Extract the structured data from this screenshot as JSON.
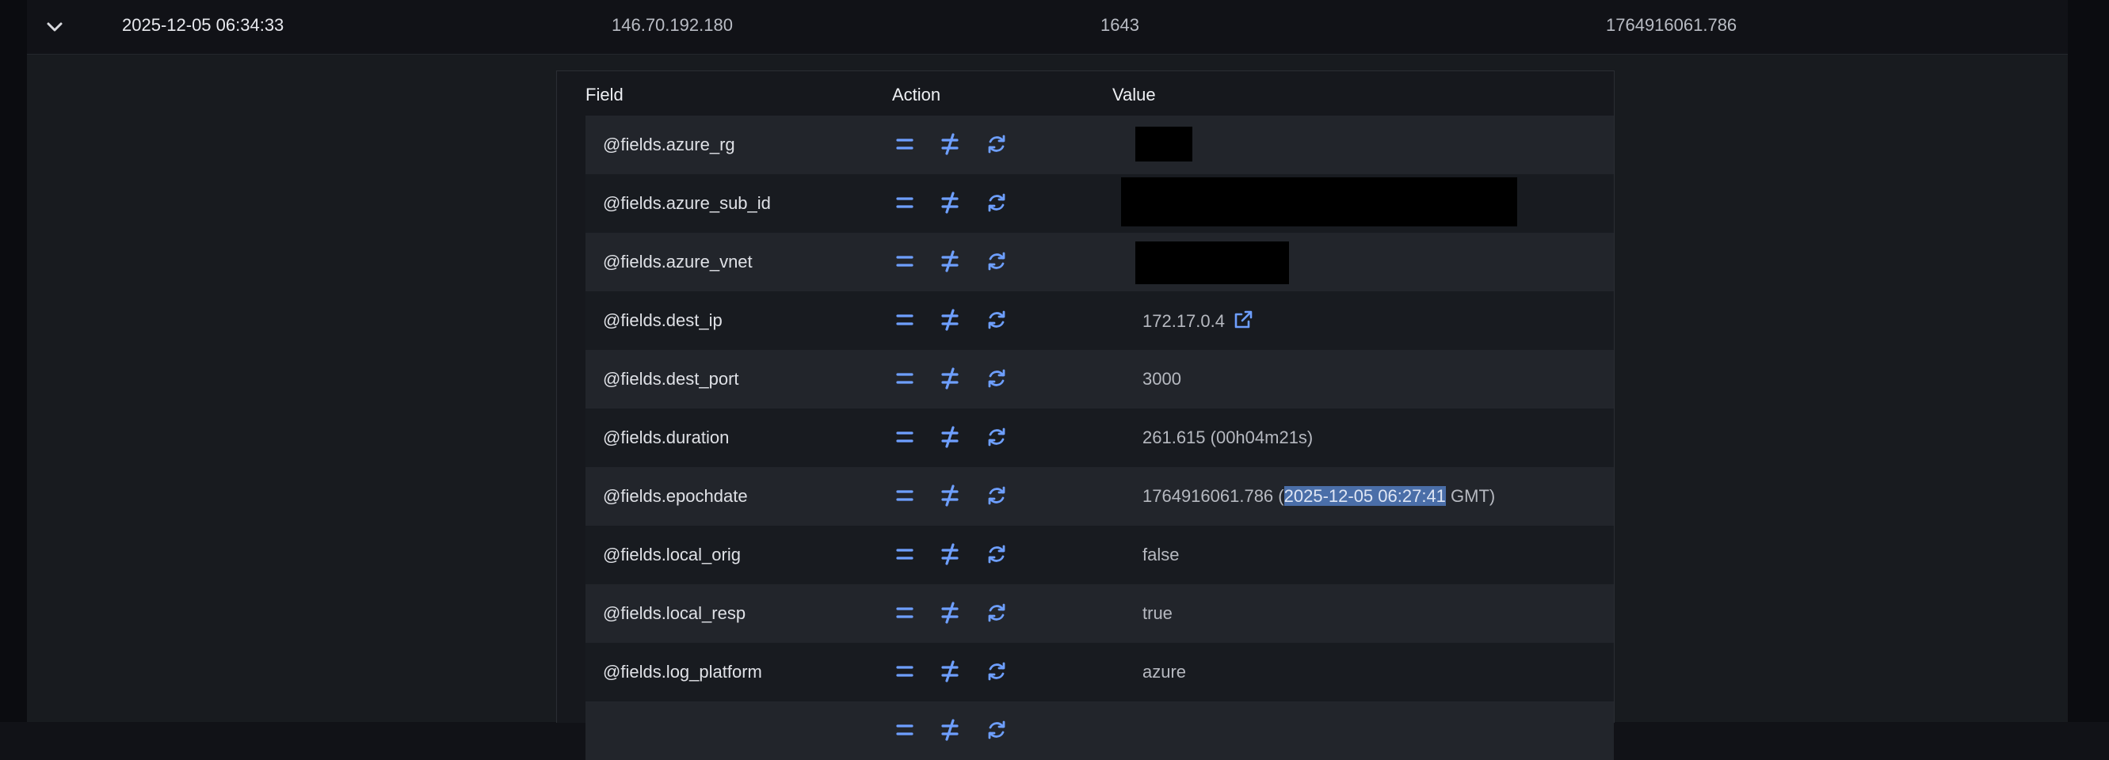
{
  "log_row": {
    "timestamp": "2025-12-05 06:34:33",
    "ip": "146.70.192.180",
    "port": "1643",
    "epoch": "1764916061.786"
  },
  "fields_table": {
    "headers": {
      "field": "Field",
      "action": "Action",
      "value": "Value"
    },
    "rows": [
      {
        "field": "@fields.azure_rg",
        "value": ""
      },
      {
        "field": "@fields.azure_sub_id",
        "value": ""
      },
      {
        "field": "@fields.azure_vnet",
        "value": ""
      },
      {
        "field": "@fields.dest_ip",
        "value": "172.17.0.4"
      },
      {
        "field": "@fields.dest_port",
        "value": "3000"
      },
      {
        "field": "@fields.duration",
        "value": "261.615 (00h04m21s)"
      },
      {
        "field": "@fields.epochdate",
        "value_prefix": "1764916061.786 (",
        "value_selected": "2025-12-05 06:27:41",
        "value_suffix": " GMT)"
      },
      {
        "field": "@fields.local_orig",
        "value": "false"
      },
      {
        "field": "@fields.local_resp",
        "value": "true"
      },
      {
        "field": "@fields.log_platform",
        "value": "azure"
      },
      {
        "field": "",
        "value": ""
      }
    ]
  },
  "icons": {
    "expand": "chevron-down-icon",
    "filter_for": "equals-icon",
    "filter_out": "not-equals-icon",
    "toggle": "refresh-icon",
    "link": "external-link-icon"
  },
  "colors": {
    "accent": "#6e9fff",
    "selection": "#4a6ea8"
  }
}
